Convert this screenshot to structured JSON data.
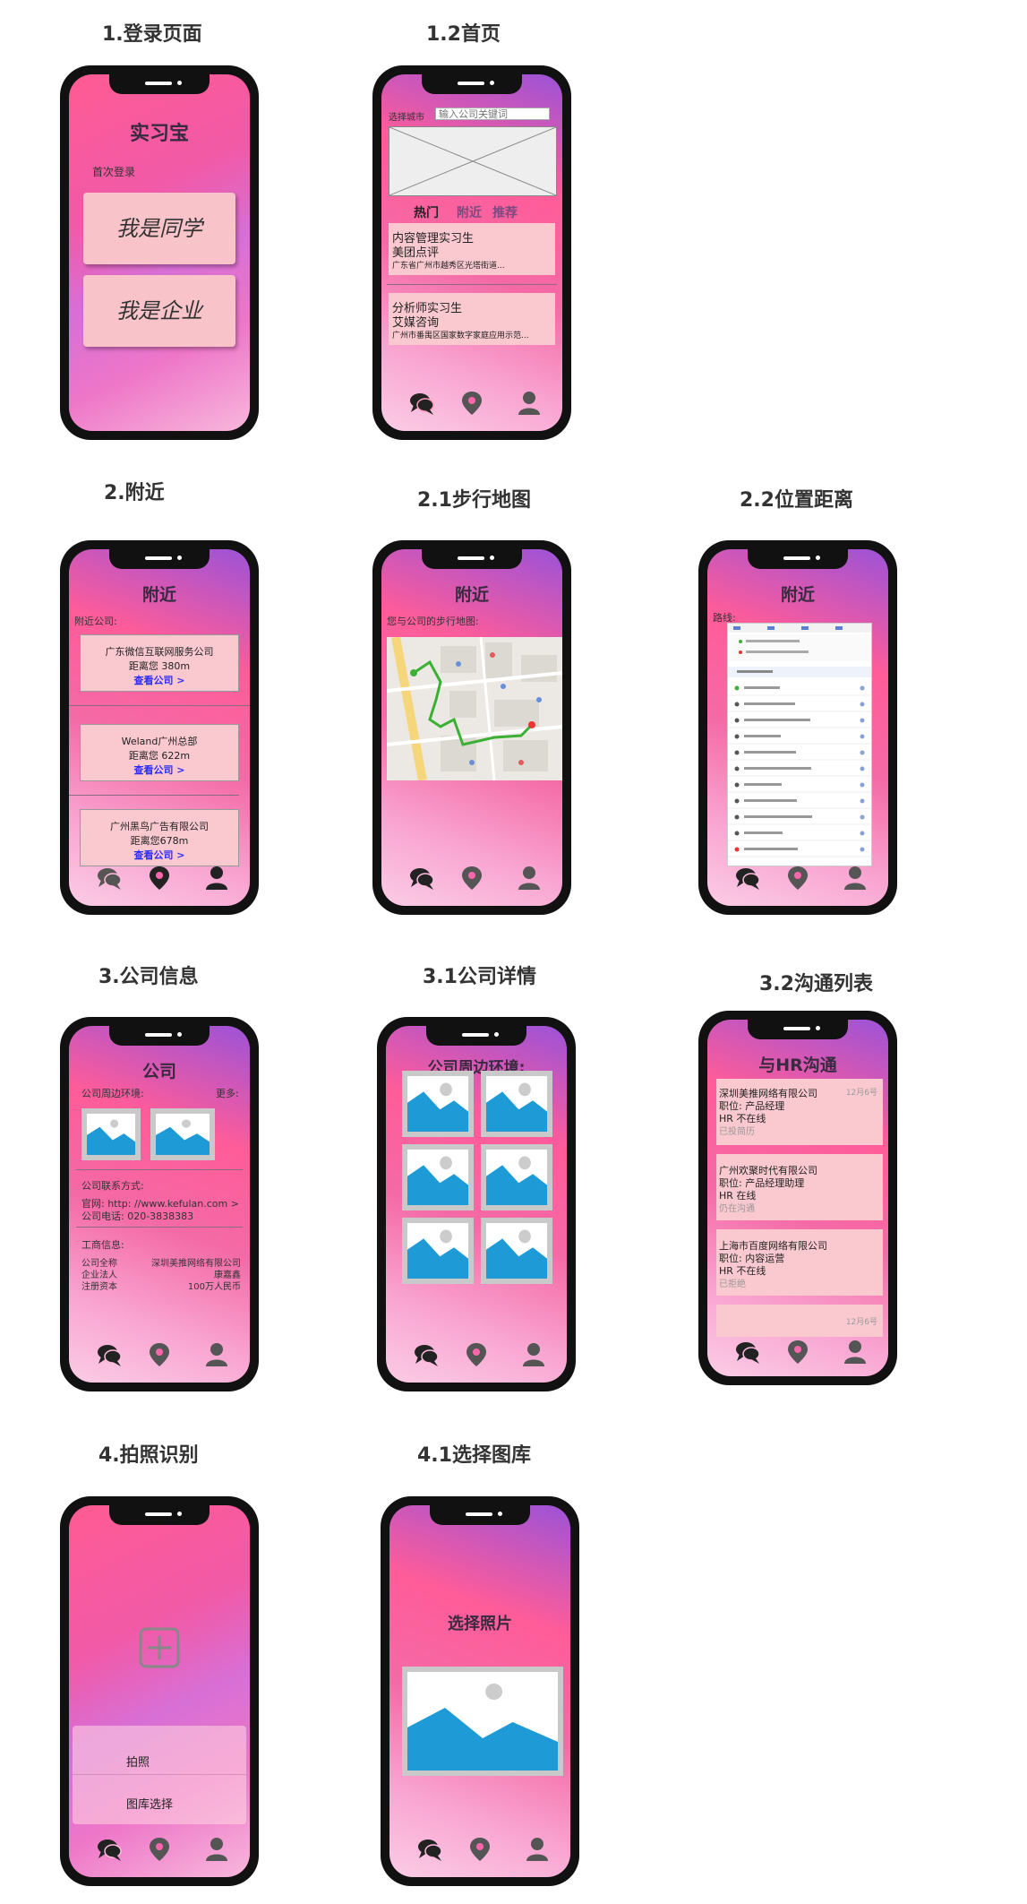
{
  "sections": {
    "s1": "1.登录页面",
    "s12": "1.2首页",
    "s2": "2.附近",
    "s21": "2.1步行地图",
    "s22": "2.2位置距离",
    "s3": "3.公司信息",
    "s31": "3.1公司详情",
    "s32": "3.2沟通列表",
    "s4": "4.拍照识别",
    "s41": "4.1选择图库"
  },
  "login": {
    "app_title": "实习宝",
    "first_login": "首次登录",
    "btn_student": "我是同学",
    "btn_company": "我是企业"
  },
  "home": {
    "city_label": "选择城市",
    "search_placeholder": "输入公司关键词",
    "tabs": [
      "热门",
      "附近",
      "推荐"
    ],
    "jobs": [
      {
        "title": "内容管理实习生",
        "company": "美团点评",
        "address": "广东省广州市越秀区光塔街道..."
      },
      {
        "title": "分析师实习生",
        "company": "艾媒咨询",
        "address": "广州市番禺区国家数字家庭应用示范..."
      }
    ]
  },
  "nearby": {
    "title": "附近",
    "label": "附近公司:",
    "companies": [
      {
        "name": "广东微信互联网服务公司",
        "distance": "距离您 380m",
        "link": "查看公司 >"
      },
      {
        "name": "Weland广州总部",
        "distance": "距离您 622m",
        "link": "查看公司 >"
      },
      {
        "name": "广州黑鸟广告有限公司",
        "distance": "距离您678m",
        "link": "查看公司 >"
      }
    ]
  },
  "walkmap": {
    "title": "附近",
    "label": "您与公司的步行地图:"
  },
  "distance": {
    "title": "附近",
    "label": "路线:"
  },
  "company": {
    "title": "公司",
    "env_label": "公司周边环境:",
    "more": "更多:",
    "contact_label": "公司联系方式:",
    "website": "官网:  http: //www.kefulan.com >",
    "phone": "公司电话:  020-3838383",
    "biz_label": "工商信息:",
    "biz_rows": [
      {
        "k": "公司全称",
        "v": "深圳美推网络有限公司"
      },
      {
        "k": "企业法人",
        "v": "康嘉鑫"
      },
      {
        "k": "注册资本",
        "v": "100万人民币"
      }
    ]
  },
  "details": {
    "title": "公司周边环境:"
  },
  "chat": {
    "title": "与HR沟通",
    "items": [
      {
        "company": "深圳美推网络有限公司",
        "position": "职位:  产品经理",
        "status": "HR 不在线",
        "note": "已投简历",
        "date": "12月6号"
      },
      {
        "company": "广州欢聚时代有限公司",
        "position": "职位:  产品经理助理",
        "status": "HR 在线",
        "note": "仍在沟通",
        "date": ""
      },
      {
        "company": "上海市百度网络有限公司",
        "position": "职位:  内容运营",
        "status": "HR 不在线",
        "note": "已拒绝",
        "date": ""
      },
      {
        "company": "",
        "position": "",
        "status": "",
        "note": "",
        "date": "12月6号"
      }
    ]
  },
  "photo": {
    "btn_photo": "拍照",
    "btn_gallery": "图库选择"
  },
  "gallery": {
    "title": "选择照片"
  },
  "colors": {
    "card": "#f9c9cf",
    "accent": "#ff5b93",
    "link": "#2b2bff"
  }
}
